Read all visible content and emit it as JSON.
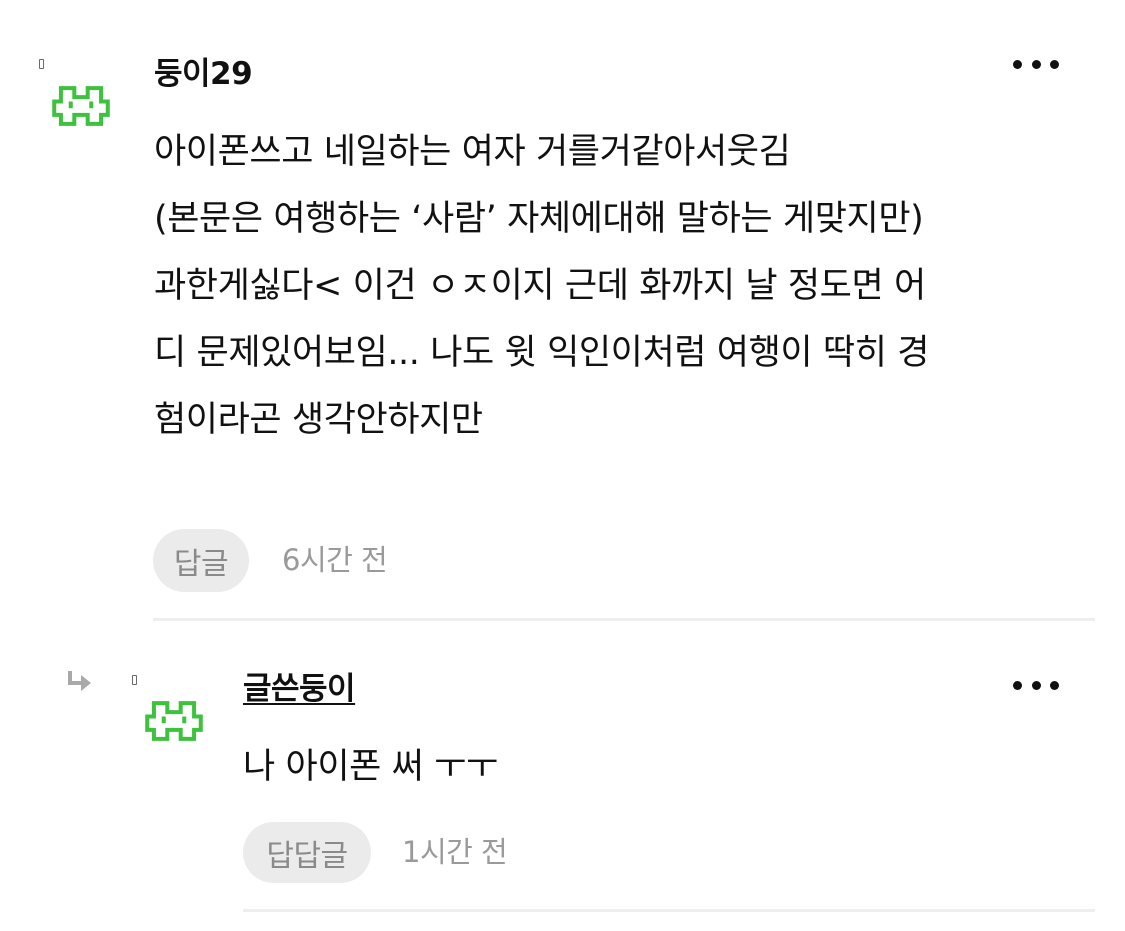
{
  "comments": [
    {
      "username": "둥이29",
      "lines": [
        "아이폰쓰고 네일하는 여자 거를거같아서웃김",
        "(본문은 여행하는 ‘사람’ 자체에대해 말하는 게맞지만)",
        "과한게싫다< 이건 ㅇㅈ이지 근데 화까지 날 정도면 어",
        "디 문제있어보임... 나도 윗 익인이처럼 여행이 딱히 경",
        "험이라곤 생각안하지만"
      ],
      "reply_label": "답글",
      "time": "6시간 전",
      "more_icon": "more-horizontal-icon",
      "avatar_icon": "pixel-monster-icon"
    },
    {
      "username": "글쓴둥이",
      "lines": [
        "나 아이폰 써 ㅜㅜ"
      ],
      "reply_label": "답답글",
      "time": "1시간 전",
      "more_icon": "more-horizontal-icon",
      "avatar_icon": "pixel-monster-icon",
      "reply_indicator_icon": "reply-arrow-icon"
    }
  ],
  "colors": {
    "avatar_green": "#3ec13e",
    "text": "#111111",
    "muted": "#9a9a9a",
    "pill_bg": "#ebebeb",
    "divider": "#eeeeee"
  }
}
